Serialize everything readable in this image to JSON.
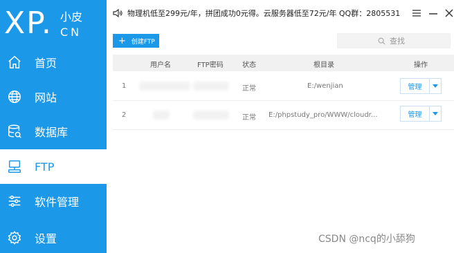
{
  "brand": {
    "logo": "XP.",
    "sub_top": "小皮",
    "sub_bottom": "CN"
  },
  "sidebar": {
    "items": [
      {
        "label": "首页",
        "icon": "home-icon"
      },
      {
        "label": "网站",
        "icon": "globe-icon"
      },
      {
        "label": "数据库",
        "icon": "database-icon"
      },
      {
        "label": "FTP",
        "icon": "ftp-icon"
      },
      {
        "label": "软件管理",
        "icon": "sliders-icon"
      },
      {
        "label": "设置",
        "icon": "gear-icon"
      }
    ],
    "active": "FTP"
  },
  "topbar": {
    "promo": "物理机低至299元/年，拼团成功0元得。云服务器低至72元/年  QQ群：2805531"
  },
  "toolbar": {
    "create_label": "创建FTP",
    "search_placeholder": "查找"
  },
  "table": {
    "headers": [
      "用户名",
      "FTP密码",
      "状态",
      "根目录",
      "操作"
    ],
    "rows": [
      {
        "index": "1",
        "status": "正常",
        "root": "E:/wenjian",
        "action": "管理"
      },
      {
        "index": "2",
        "status": "正常",
        "root": "E:/phpstudy_pro/WWW/cloudr...",
        "action": "管理"
      }
    ]
  },
  "watermark": "CSDN @ncq的小舔狗",
  "colors": {
    "accent": "#1c98e8",
    "sidebar_bg": "#1c98e8"
  }
}
